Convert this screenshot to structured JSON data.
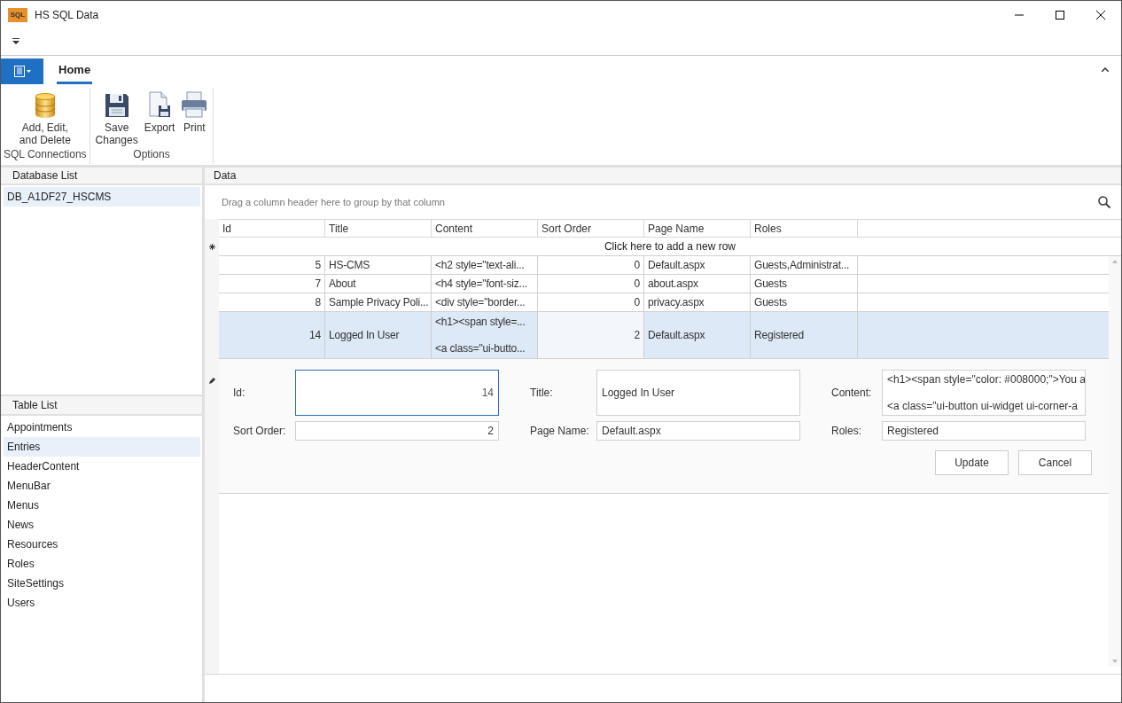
{
  "window": {
    "title": "HS SQL Data",
    "icon_text": "SQL"
  },
  "ribbon": {
    "tabs": [
      {
        "label": "Home",
        "selected": true
      }
    ],
    "groups": [
      {
        "label": "SQL Connections",
        "buttons": [
          {
            "label": "Add, Edit,\nand Delete",
            "kind": "database"
          }
        ]
      },
      {
        "label": "Options",
        "buttons": [
          {
            "label": "Save\nChanges",
            "kind": "save"
          },
          {
            "label": "Export",
            "kind": "export"
          },
          {
            "label": "Print",
            "kind": "print"
          }
        ]
      }
    ]
  },
  "database_list": {
    "header": "Database List",
    "items": [
      {
        "label": "DB_A1DF27_HSCMS",
        "selected": true
      }
    ]
  },
  "table_list": {
    "header": "Table List",
    "items": [
      {
        "label": "Appointments",
        "selected": false
      },
      {
        "label": "Entries",
        "selected": true
      },
      {
        "label": "HeaderContent",
        "selected": false
      },
      {
        "label": "MenuBar",
        "selected": false
      },
      {
        "label": "Menus",
        "selected": false
      },
      {
        "label": "News",
        "selected": false
      },
      {
        "label": "Resources",
        "selected": false
      },
      {
        "label": "Roles",
        "selected": false
      },
      {
        "label": "SiteSettings",
        "selected": false
      },
      {
        "label": "Users",
        "selected": false
      }
    ]
  },
  "data_panel": {
    "header": "Data",
    "group_panel_hint": "Drag a column header here to group by that column",
    "table": {
      "columns": [
        "Id",
        "Title",
        "Content",
        "Sort Order",
        "Page Name",
        "Roles"
      ],
      "new_row_text": "Click here to add a new row",
      "rows": [
        {
          "cells": [
            "5",
            "HS-CMS",
            "<h2 style=\"text-ali...",
            "0",
            "Default.aspx",
            "Guests,Administrat..."
          ],
          "selected": false
        },
        {
          "cells": [
            "7",
            "About",
            "<h4 style=\"font-siz...",
            "0",
            "about.aspx",
            "Guests"
          ],
          "selected": false
        },
        {
          "cells": [
            "8",
            "Sample Privacy Poli...",
            "<div style=\"border...",
            "0",
            "privacy.aspx",
            "Guests"
          ],
          "selected": false
        },
        {
          "cells": [
            "14",
            "Logged In User",
            "<h1><span style=...\n\n<a class=\"ui-butto...",
            "2",
            "Default.aspx",
            "Registered"
          ],
          "selected": true
        }
      ]
    },
    "edit_form": {
      "fields": [
        {
          "label": "Id:",
          "value": "14",
          "kind": "number",
          "focused": true
        },
        {
          "label": "Title:",
          "value": "Logged In User",
          "kind": "text",
          "focused": false
        },
        {
          "label": "Content:",
          "value": "<h1><span style=\"color: #008000;\">You a\n\n<a class=\"ui-button ui-widget ui-corner-a",
          "kind": "memo",
          "focused": false
        },
        {
          "label": "Sort Order:",
          "value": "2",
          "kind": "number",
          "focused": false
        },
        {
          "label": "Page Name:",
          "value": "Default.aspx",
          "kind": "text",
          "focused": false
        },
        {
          "label": "Roles:",
          "value": "Registered",
          "kind": "text",
          "focused": false
        }
      ],
      "buttons": [
        "Update",
        "Cancel"
      ]
    }
  }
}
